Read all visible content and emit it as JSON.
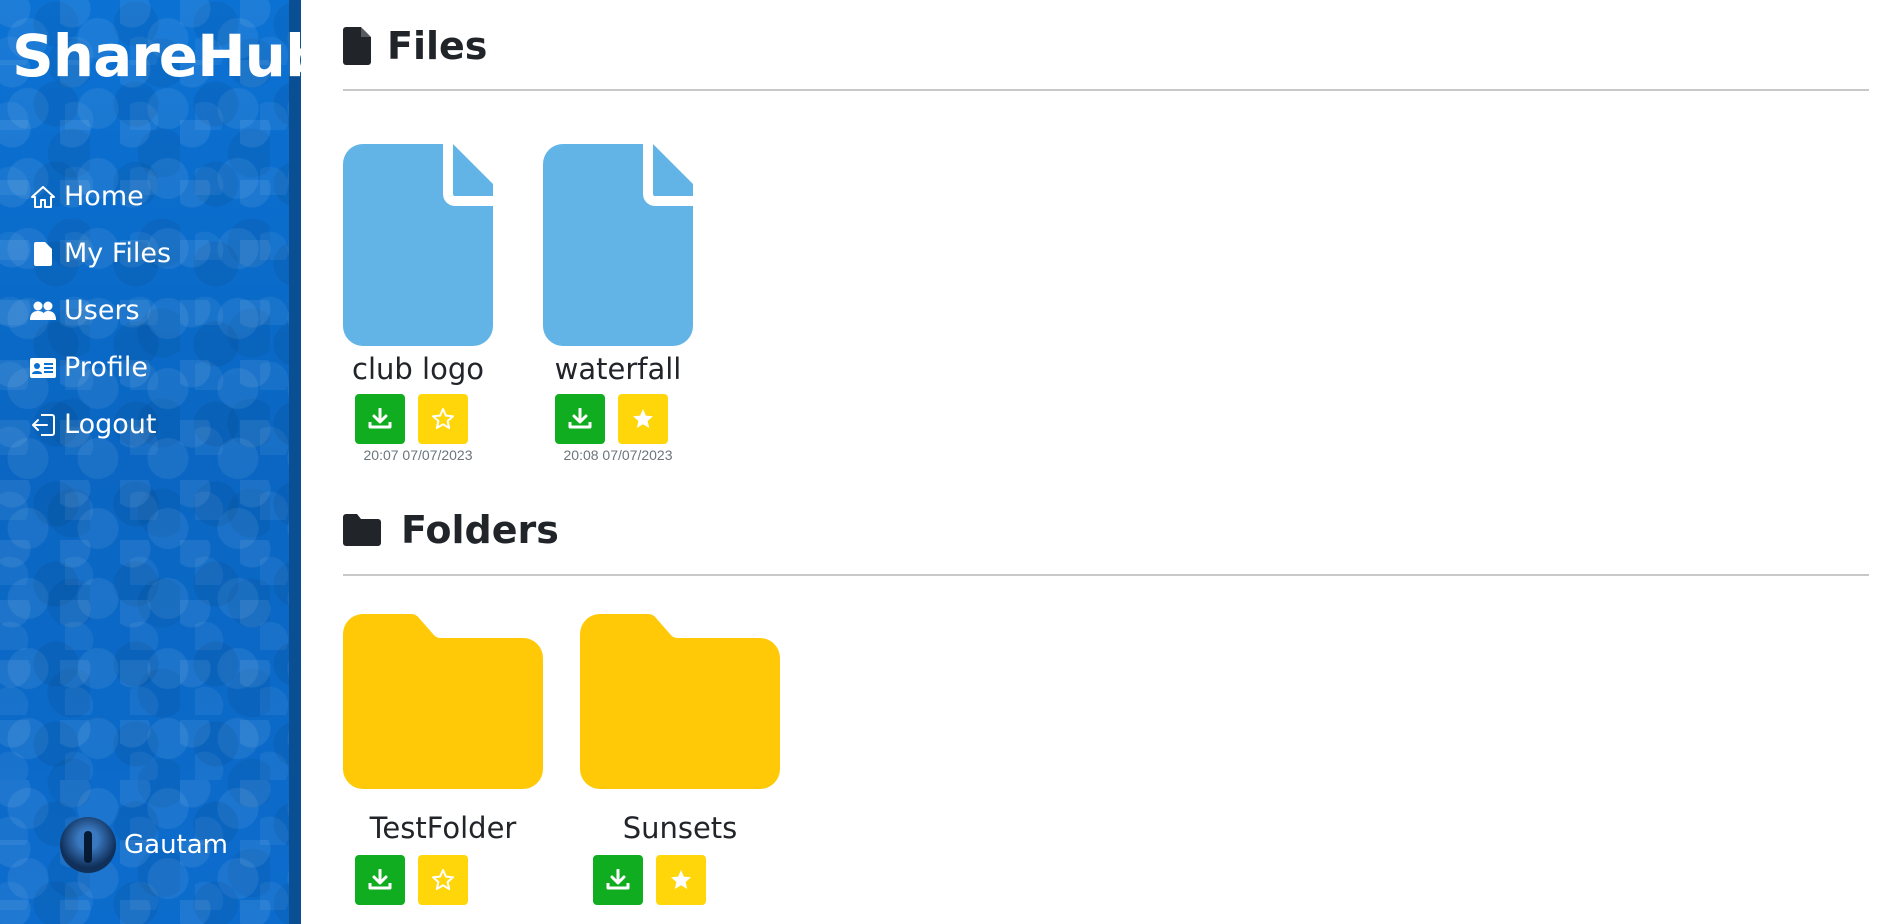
{
  "app": {
    "brand": "ShareHub"
  },
  "sidebar": {
    "items": [
      {
        "label": "Home",
        "icon": "home-icon"
      },
      {
        "label": "My Files",
        "icon": "file-icon"
      },
      {
        "label": "Users",
        "icon": "users-icon"
      },
      {
        "label": "Profile",
        "icon": "id-card-icon"
      },
      {
        "label": "Logout",
        "icon": "logout-icon"
      }
    ],
    "user": {
      "name": "Gautam"
    }
  },
  "files": {
    "title": "Files",
    "items": [
      {
        "name": "club logo",
        "timestamp": "20:07 07/07/2023",
        "starred": false
      },
      {
        "name": "waterfall",
        "timestamp": "20:08 07/07/2023",
        "starred": true
      }
    ]
  },
  "folders": {
    "title": "Folders",
    "items": [
      {
        "name": "TestFolder",
        "starred": false
      },
      {
        "name": "Sunsets",
        "starred": true
      }
    ]
  },
  "colors": {
    "sidebar": "#0a6fcf",
    "file_icon": "#62b4e6",
    "folder_icon": "#ffc907",
    "download_button": "#0fad1f",
    "star_button": "#ffd60a"
  }
}
